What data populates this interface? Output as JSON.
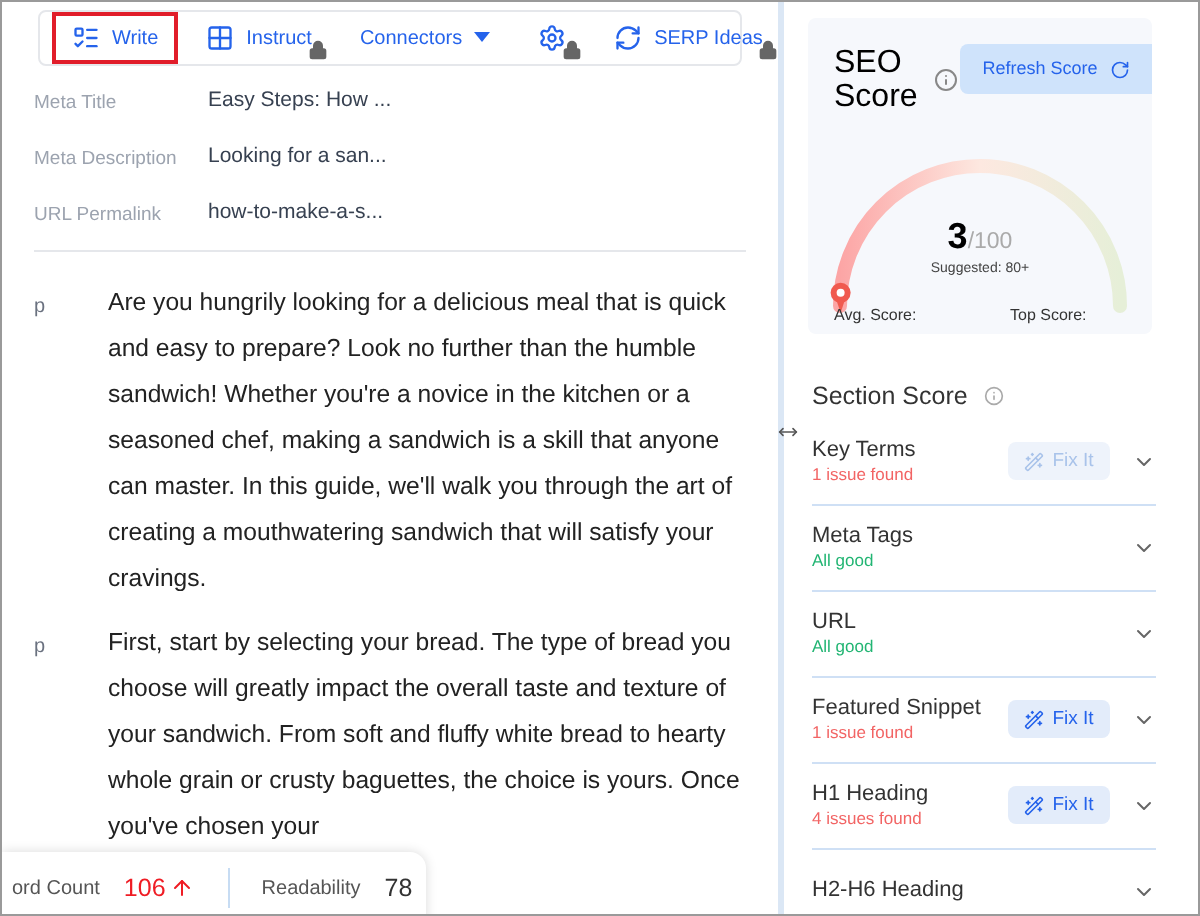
{
  "toolbar": {
    "tabs": [
      {
        "label": "Write",
        "selected": true,
        "locked": false,
        "dropdown": false
      },
      {
        "label": "Instruct",
        "selected": false,
        "locked": true,
        "dropdown": false
      },
      {
        "label": "Connectors",
        "selected": false,
        "locked": false,
        "dropdown": true
      },
      {
        "selected": false,
        "locked": true,
        "dropdown": false
      },
      {
        "label": "SERP Ideas",
        "selected": false,
        "locked": true,
        "dropdown": false
      }
    ]
  },
  "meta": [
    {
      "label": "Meta Title",
      "value": "Easy Steps: How ..."
    },
    {
      "label": "Meta Description",
      "value": "Looking for a san..."
    },
    {
      "label": "URL Permalink",
      "value": "how-to-make-a-s..."
    }
  ],
  "paragraphs": [
    {
      "tag": "p",
      "text": "Are you hungrily looking for a delicious meal that is quick and easy to prepare? Look no further than the humble sandwich! Whether you're a novice in the kitchen or a seasoned chef, making a sandwich is a skill that anyone can master. In this guide, we'll walk you through the art of creating a mouthwatering sandwich that will satisfy your cravings."
    },
    {
      "tag": "p",
      "text": "First, start by selecting your bread. The type of bread you choose will greatly impact the overall taste and texture of your sandwich. From soft and fluffy white bread to hearty whole grain or crusty baguettes, the choice is yours. Once you've chosen your"
    }
  ],
  "stats": {
    "word_count_label": "ord Count",
    "word_count": "106",
    "readability_label": "Readability",
    "readability": "78"
  },
  "seo_score": {
    "title": "SEO Score",
    "refresh_label": "Refresh Score",
    "score": "3",
    "max": "/100",
    "suggested": "Suggested: 80+",
    "level": 0.03,
    "avg_label": "Avg. Score:",
    "top_label": "Top Score:"
  },
  "section_score": {
    "title": "Section Score",
    "sections": [
      {
        "name": "Key Terms",
        "status": "1 issue found",
        "ok": false,
        "fix": {
          "label": "Fix It",
          "disabled": true
        }
      },
      {
        "name": "Meta Tags",
        "status": "All good",
        "ok": true
      },
      {
        "name": "URL",
        "status": "All good",
        "ok": true
      },
      {
        "name": "Featured Snippet",
        "status": "1 issue found",
        "ok": false,
        "fix": {
          "label": "Fix It",
          "disabled": false
        }
      },
      {
        "name": "H1 Heading",
        "status": "4 issues found",
        "ok": false,
        "fix": {
          "label": "Fix It",
          "disabled": false
        }
      },
      {
        "name": "H2-H6 Heading"
      }
    ]
  }
}
